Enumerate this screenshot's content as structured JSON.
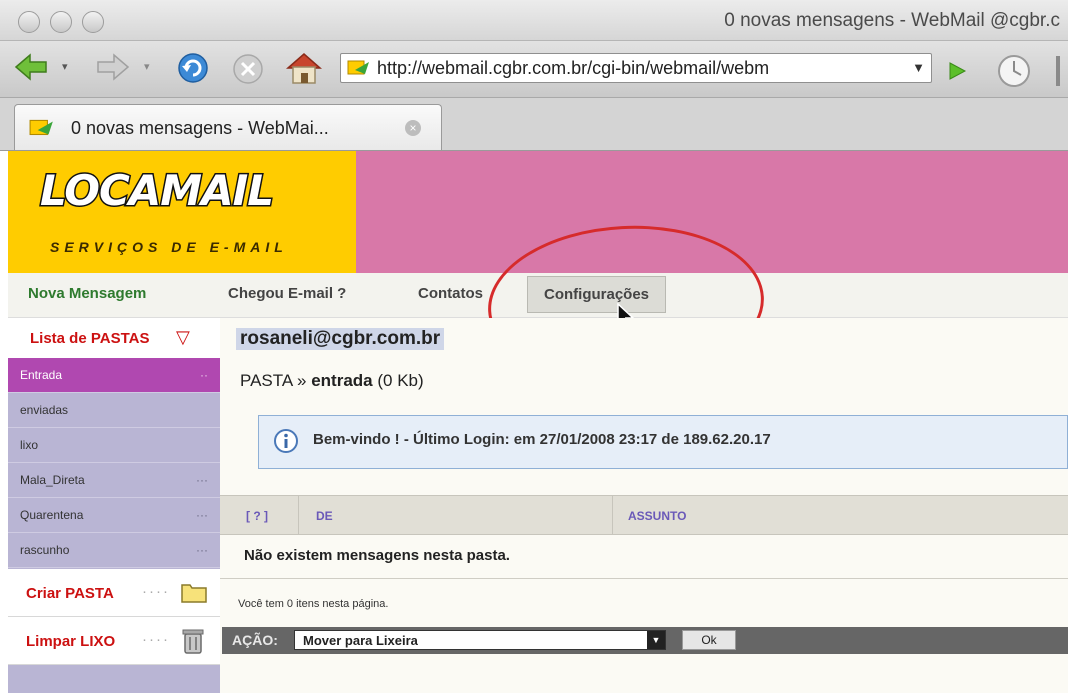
{
  "window": {
    "title": "0 novas mensagens - WebMail @cgbr.c"
  },
  "toolbar": {
    "url": "http://webmail.cgbr.com.br/cgi-bin/webmail/webm"
  },
  "tab": {
    "label": "0 novas mensagens - WebMai..."
  },
  "banner": {
    "logo": "LOCAMAIL",
    "subtitle": "SERVIÇOS DE E-MAIL",
    "colors": {
      "left": "#ffcc00",
      "right": "#d878a8"
    }
  },
  "menu": {
    "new_message": "Nova Mensagem",
    "check_mail": "Chegou E-mail ?",
    "contacts": "Contatos",
    "settings": "Configurações"
  },
  "sidebar": {
    "folders_title": "Lista de PASTAS",
    "folders": [
      {
        "name": "Entrada",
        "active": true
      },
      {
        "name": "enviadas",
        "active": false
      },
      {
        "name": "lixo",
        "active": false
      },
      {
        "name": "Mala_Direta",
        "active": false
      },
      {
        "name": "Quarentena",
        "active": false
      },
      {
        "name": "rascunho",
        "active": false
      }
    ],
    "create_folder": "Criar PASTA",
    "empty_trash": "Limpar LIXO"
  },
  "main": {
    "account": "rosaneli@cgbr.com.br",
    "pasta_prefix": "PASTA »",
    "folder_name": "entrada",
    "folder_size": "(0 Kb)",
    "welcome": "Bem-vindo ! - Último Login: em 27/01/2008 23:17 de 189.62.20.17",
    "table": {
      "col_help": "[ ? ]",
      "col_from": "DE",
      "col_subject": "ASSUNTO",
      "empty_message": "Não existem mensagens nesta pasta."
    },
    "items_count": "Você tem 0 itens nesta página.",
    "action_label": "AÇÃO:",
    "action_selected": "Mover para Lixeira",
    "ok_label": "Ok"
  }
}
